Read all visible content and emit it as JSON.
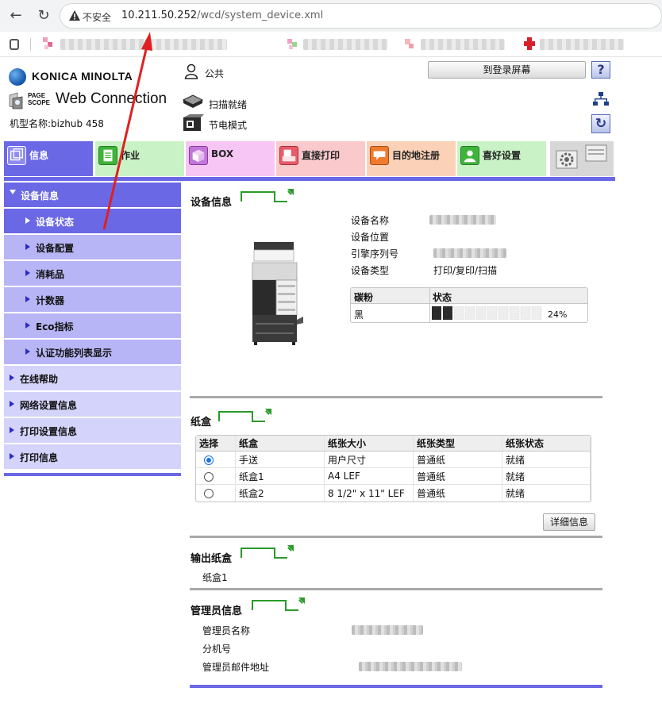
{
  "browser": {
    "insecure_label": "不安全",
    "url_host": "10.211.50.252",
    "url_path": "/wcd/system_device.xml"
  },
  "header": {
    "brand": "KONICA MINOLTA",
    "page_scope_line1": "PAGE",
    "page_scope_line2": "SCOPE",
    "product": "Web Connection",
    "model_label": "机型名称:",
    "model_value": "bizhub 458",
    "user": "公共",
    "status_scan": "扫描就绪",
    "status_power": "节电模式",
    "login_button": "到登录屏幕",
    "help_button": "?"
  },
  "tabs": [
    {
      "label": "信息",
      "color": "#6b68e6",
      "text_color": "#ffffff"
    },
    {
      "label": "作业",
      "color": "#c9f3c6",
      "text_color": "#222222"
    },
    {
      "label": "BOX",
      "color": "#f7c6f4",
      "text_color": "#222222"
    },
    {
      "label": "直接打印",
      "color": "#f9c9cc",
      "text_color": "#222222"
    },
    {
      "label": "目的地注册",
      "color": "#fbd2b8",
      "text_color": "#222222"
    },
    {
      "label": "喜好设置",
      "color": "#c9f3c6",
      "text_color": "#222222"
    }
  ],
  "nav": [
    {
      "label": "设备信息",
      "level": 0,
      "expanded": true
    },
    {
      "label": "设备状态",
      "level": 1,
      "selected": true
    },
    {
      "label": "设备配置",
      "level": 1
    },
    {
      "label": "消耗品",
      "level": 1
    },
    {
      "label": "计数器",
      "level": 1
    },
    {
      "label": "Eco指标",
      "level": 1
    },
    {
      "label": "认证功能列表显示",
      "level": 1
    },
    {
      "label": "在线帮助",
      "level": 0
    },
    {
      "label": "网络设置信息",
      "level": 0
    },
    {
      "label": "打印设置信息",
      "level": 0
    },
    {
      "label": "打印信息",
      "level": 0
    }
  ],
  "device_info": {
    "title": "设备信息",
    "labels": [
      "设备名称",
      "设备位置",
      "引擎序列号",
      "设备类型"
    ],
    "device_type": "打印/复印/扫描",
    "toner": {
      "header_toner": "碳粉",
      "header_status": "状态",
      "color_name": "黑",
      "level_percent": 24,
      "level_text": "24%"
    }
  },
  "paper_tray": {
    "title": "纸盒",
    "columns": [
      "选择",
      "纸盒",
      "纸张大小",
      "纸张类型",
      "纸张状态"
    ],
    "rows": [
      {
        "selected": true,
        "tray": "手送",
        "size": "用户尺寸",
        "type": "普通纸",
        "status": "就绪"
      },
      {
        "selected": false,
        "tray": "纸盒1",
        "size": "A4 LEF",
        "type": "普通纸",
        "status": "就绪"
      },
      {
        "selected": false,
        "tray": "纸盒2",
        "size": "8 1/2\" x 11\" LEF",
        "type": "普通纸",
        "status": "就绪"
      }
    ],
    "detail_button": "详细信息"
  },
  "output_tray": {
    "title": "输出纸盒",
    "value": "纸盒1"
  },
  "admin_info": {
    "title": "管理员信息",
    "labels": [
      "管理员名称",
      "分机号",
      "管理员邮件地址"
    ]
  },
  "colors": {
    "accent": "#6b68e6",
    "nav_selected": "#6b68e6",
    "nav_sub": "#b7b5f5",
    "nav_top": "#d4d3fb",
    "annotation_arrow": "#e02020"
  }
}
